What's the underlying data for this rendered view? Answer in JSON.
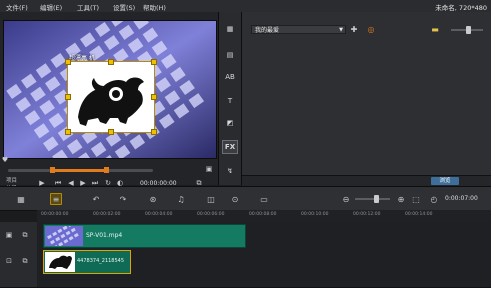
{
  "menu": {
    "items": [
      "文件(F)",
      "编辑(E)",
      "工具(T)",
      "设置(S)",
      "帮助(H)"
    ],
    "window_title": "未命名, 720*480"
  },
  "preview": {
    "caption": "超漂亮  机",
    "project_label": "项目",
    "clip_label": "片段",
    "timecode": "00:00:00:00"
  },
  "library": {
    "dropdown_value": "我的最爱",
    "browse_label": "浏览"
  },
  "sidebar": {
    "fx_label": "FX"
  },
  "toolbar": {
    "timecode": "0:00:07:00"
  },
  "ruler": {
    "labels": [
      "00:00:00:00",
      "00:00:02:00",
      "00:00:04:00",
      "00:00:06:00",
      "00:00:08:00",
      "00:00:10:00",
      "00:00:12:00",
      "00:00:14:00"
    ]
  },
  "timeline": {
    "clips": [
      {
        "label": "SP-V01.mp4"
      },
      {
        "label": "4478374_2118545"
      }
    ]
  },
  "colors": {
    "accent": "#e07b1e",
    "clip_green": "#157a62",
    "selection": "#e1a300"
  },
  "icons": [
    "play-icon",
    "stop-icon",
    "step-back-icon",
    "step-forward-icon",
    "repeat-icon",
    "volume-icon",
    "fx-icon",
    "title-icon",
    "media-icon",
    "undo-icon",
    "redo-icon",
    "zoom-in-icon",
    "zoom-out-icon",
    "storyboard-icon",
    "timeline-icon"
  ]
}
